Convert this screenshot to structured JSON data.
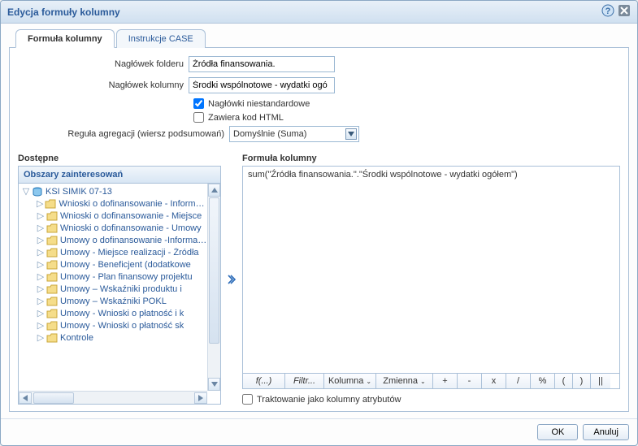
{
  "dialog": {
    "title": "Edycja formuły kolumny"
  },
  "tabs": {
    "formula": "Formuła kolumny",
    "case": "Instrukcje CASE"
  },
  "form": {
    "folder_label": "Nagłówek folderu",
    "folder_value": "Źródła finansowania.",
    "column_label": "Nagłówek kolumny",
    "column_value": "Środki wspólnotowe - wydatki ogó",
    "chk_custom_headers": "Nagłówki niestandardowe",
    "chk_contains_html": "Zawiera kod HTML",
    "aggregation_label": "Reguła agregacji (wiersz podsumowań)",
    "aggregation_value": "Domyślnie (Suma)"
  },
  "left_pane": {
    "title": "Dostępne",
    "areas_header": "Obszary zainteresowań",
    "root": "KSI SIMIK 07-13",
    "items": [
      "Wnioski o dofinansowanie - Informacje ogólne",
      "Wnioski o dofinansowanie - Miejsce",
      "Wnioski o dofinansowanie - Umowy",
      "Umowy o dofinansowanie -Informacje",
      "Umowy - Miejsce realizacji - Źródła",
      "Umowy - Beneficjent (dodatkowe",
      "Umowy - Plan finansowy projektu",
      "Umowy – Wskaźniki produktu i",
      "Umowy – Wskaźniki POKL",
      "Umowy - Wnioski o płatność i k",
      "Umowy - Wnioski o płatność sk",
      "Kontrole"
    ]
  },
  "right_pane": {
    "title": "Formuła kolumny",
    "formula_text": "sum(\"Źródła finansowania.\".\"Środki wspólnotowe - wydatki ogółem\")"
  },
  "toolbar": {
    "fx": "f(...)",
    "filter": "Filtr...",
    "column": "Kolumna",
    "variable": "Zmienna",
    "plus": "+",
    "minus": "-",
    "times": "x",
    "div": "/",
    "pct": "%",
    "lparen": "(",
    "rparen": ")",
    "concat": "||"
  },
  "chk_attr_label": "Traktowanie jako kolumny atrybutów",
  "footer": {
    "ok": "OK",
    "cancel": "Anuluj"
  }
}
